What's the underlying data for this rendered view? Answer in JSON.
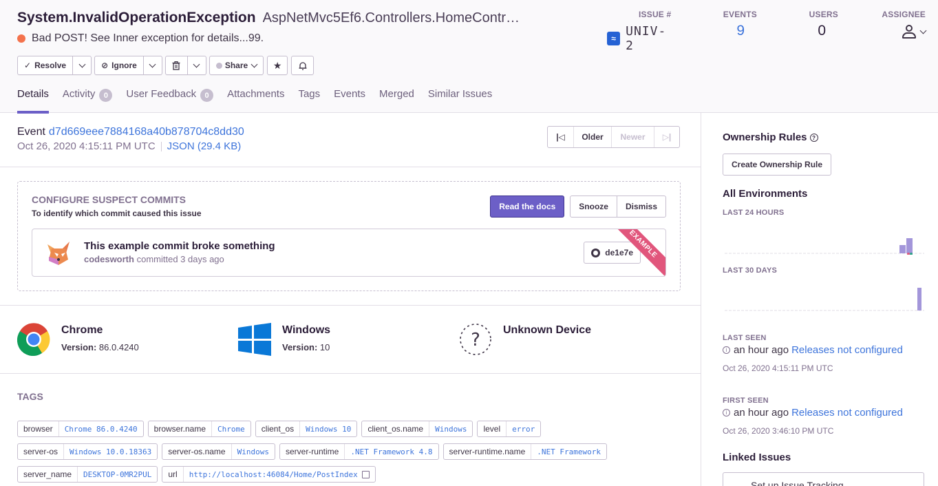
{
  "issue": {
    "title": "System.InvalidOperationException",
    "culprit": "AspNetMvc5Ef6.Controllers.HomeContr…",
    "message": "Bad POST! See Inner exception for details...99.",
    "level_color": "#f4724c"
  },
  "stats": {
    "issue_label": "ISSUE #",
    "issue_value": "UNIV-2",
    "events_label": "EVENTS",
    "events_value": "9",
    "users_label": "USERS",
    "users_value": "0",
    "assignee_label": "ASSIGNEE"
  },
  "actions": {
    "resolve": "Resolve",
    "ignore": "Ignore",
    "share": "Share"
  },
  "tabs": [
    {
      "label": "Details"
    },
    {
      "label": "Activity",
      "badge": "0"
    },
    {
      "label": "User Feedback",
      "badge": "0"
    },
    {
      "label": "Attachments"
    },
    {
      "label": "Tags"
    },
    {
      "label": "Events"
    },
    {
      "label": "Merged"
    },
    {
      "label": "Similar Issues"
    }
  ],
  "event": {
    "label": "Event",
    "id": "d7d669eee7884168a40b878704c8dd30",
    "date": "Oct 26, 2020 4:15:11 PM UTC",
    "json": "JSON (29.4 KB)",
    "older": "Older",
    "newer": "Newer"
  },
  "suspect": {
    "title": "CONFIGURE SUSPECT COMMITS",
    "desc": "To identify which commit caused this issue",
    "read_docs": "Read the docs",
    "snooze": "Snooze",
    "dismiss": "Dismiss",
    "commit_msg": "This example commit broke something",
    "author": "codesworth",
    "committed": "committed 3 days ago",
    "sha": "de1e7e",
    "ribbon": "EXAMPLE"
  },
  "contexts": [
    {
      "title": "Chrome",
      "version_label": "Version:",
      "version": "86.0.4240"
    },
    {
      "title": "Windows",
      "version_label": "Version:",
      "version": "10"
    },
    {
      "title": "Unknown Device"
    }
  ],
  "tags": {
    "title": "TAGS",
    "rows": [
      [
        {
          "k": "browser",
          "v": "Chrome 86.0.4240"
        },
        {
          "k": "browser.name",
          "v": "Chrome"
        },
        {
          "k": "client_os",
          "v": "Windows 10"
        },
        {
          "k": "client_os.name",
          "v": "Windows"
        },
        {
          "k": "level",
          "v": "error"
        }
      ],
      [
        {
          "k": "server-os",
          "v": "Windows 10.0.18363"
        },
        {
          "k": "server-os.name",
          "v": "Windows"
        },
        {
          "k": "server-runtime",
          "v": ".NET Framework 4.8"
        },
        {
          "k": "server-runtime.name",
          "v": ".NET Framework"
        }
      ],
      [
        {
          "k": "server_name",
          "v": "DESKTOP-0MR2PUL"
        },
        {
          "k": "url",
          "v": "http://localhost:46084/Home/PostIndex"
        }
      ]
    ]
  },
  "sidebar": {
    "ownership_title": "Ownership Rules",
    "create_rule": "Create Ownership Rule",
    "environments": "All Environments",
    "last24": "LAST 24 HOURS",
    "last30": "LAST 30 DAYS",
    "last_seen_label": "LAST SEEN",
    "last_seen": "an hour ago",
    "releases": "Releases not configured",
    "last_seen_date": "Oct 26, 2020 4:15:11 PM UTC",
    "first_seen_label": "FIRST SEEN",
    "first_seen": "an hour ago",
    "first_seen_date": "Oct 26, 2020 3:46:10 PM UTC",
    "linked_issues": "Linked Issues",
    "setup_tracking": "Set up Issue Tracking"
  },
  "colors": {
    "accent": "#6c5fc7",
    "link": "#3d74db",
    "ribbon": "#e1567c",
    "bar": "#a396da"
  }
}
